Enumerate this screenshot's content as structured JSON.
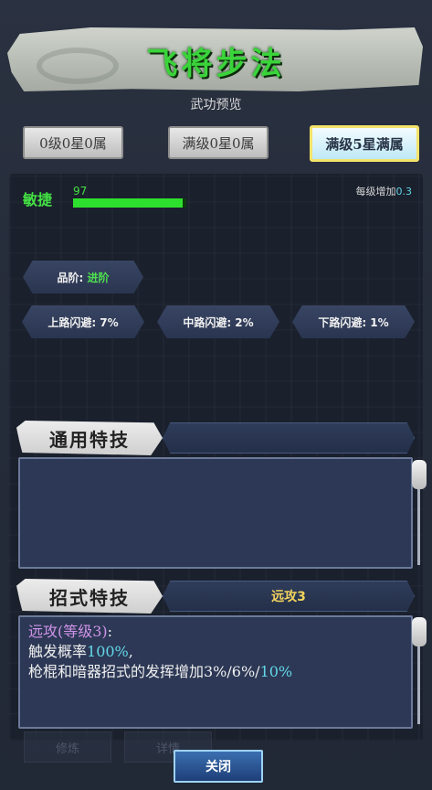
{
  "header": {
    "title": "飞将步法",
    "subtitle": "武功预览"
  },
  "tabs": [
    {
      "label": "0级0星0属"
    },
    {
      "label": "满级0星0属"
    },
    {
      "label": "满级5星满属"
    }
  ],
  "stat": {
    "name": "敏捷",
    "value": "97",
    "bar_fraction": 0.97,
    "growth_label": "每级增加",
    "growth_value": "0.3"
  },
  "grade": {
    "label": "品阶:",
    "value": "进阶"
  },
  "dodges": [
    {
      "label": "上路闪避: 7%"
    },
    {
      "label": "中路闪避: 2%"
    },
    {
      "label": "下路闪避: 1%"
    }
  ],
  "general_section": {
    "title": "通用特技"
  },
  "move_section": {
    "title": "招式特技",
    "tab_label": "远攻3",
    "skill_name": "远攻(等级3)",
    "colon": ":",
    "trigger_label": "触发概率",
    "trigger_value": "100%",
    "trigger_suffix": ",",
    "effect_label": "枪棍和暗器招式的发挥增加3%/6%/",
    "effect_value": "10%"
  },
  "footer": {
    "ghost_left": "修炼",
    "ghost_right": "详情",
    "close_label": "关闭"
  },
  "colors": {
    "title": "#3ad43a",
    "stat": "#43e043",
    "cyan": "#63d7e8",
    "purple": "#d093e8",
    "gold": "#f2d35c"
  }
}
